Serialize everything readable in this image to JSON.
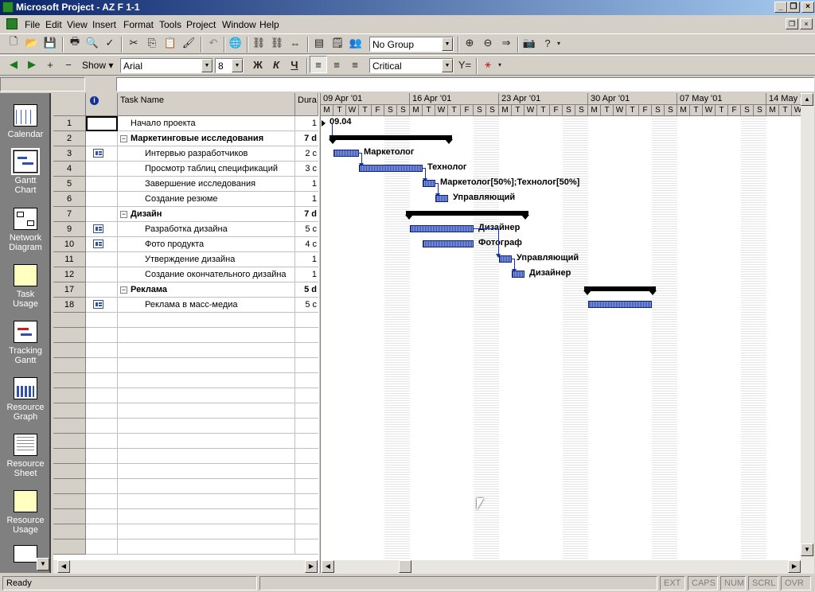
{
  "window": {
    "title": "Microsoft Project - AZ F 1-1"
  },
  "menu": [
    "File",
    "Edit",
    "View",
    "Insert",
    "Format",
    "Tools",
    "Project",
    "Window",
    "Help"
  ],
  "toolbar1": {
    "group_value": "No Group"
  },
  "toolbar2": {
    "show_label": "Show",
    "font_value": "Arial",
    "size_value": "8",
    "bold": "Ж",
    "italic": "К",
    "underline": "Ч",
    "filter_value": "Critical"
  },
  "grid": {
    "columns": {
      "indicators": "i",
      "name": "Task Name",
      "duration": "Dura"
    },
    "rows": [
      {
        "id": "1",
        "name": "Начало проекта",
        "duration": "1",
        "level": 0,
        "summary": false,
        "note": false
      },
      {
        "id": "2",
        "name": "Маркетинговые исследования",
        "duration": "7 d",
        "level": 0,
        "summary": true,
        "note": false
      },
      {
        "id": "3",
        "name": "Интервью разработчиков",
        "duration": "2 c",
        "level": 1,
        "summary": false,
        "note": true
      },
      {
        "id": "4",
        "name": "Просмотр таблиц спецификаций",
        "duration": "3 c",
        "level": 1,
        "summary": false,
        "note": false
      },
      {
        "id": "5",
        "name": "Завершение исследования",
        "duration": "1",
        "level": 1,
        "summary": false,
        "note": false
      },
      {
        "id": "6",
        "name": "Создание резюме",
        "duration": "1",
        "level": 1,
        "summary": false,
        "note": false
      },
      {
        "id": "7",
        "name": "Дизайн",
        "duration": "7 d",
        "level": 0,
        "summary": true,
        "note": false
      },
      {
        "id": "9",
        "name": "Разработка дизайна",
        "duration": "5 c",
        "level": 1,
        "summary": false,
        "note": true
      },
      {
        "id": "10",
        "name": "Фото продукта",
        "duration": "4 c",
        "level": 1,
        "summary": false,
        "note": true
      },
      {
        "id": "11",
        "name": "Утверждение дизайна",
        "duration": "1",
        "level": 1,
        "summary": false,
        "note": false
      },
      {
        "id": "12",
        "name": "Создание окончательного дизайна",
        "duration": "1",
        "level": 1,
        "summary": false,
        "note": false
      },
      {
        "id": "17",
        "name": "Реклама",
        "duration": "5 d",
        "level": 0,
        "summary": true,
        "note": false
      },
      {
        "id": "18",
        "name": "Реклама в масс-медиа",
        "duration": "5 c",
        "level": 1,
        "summary": false,
        "note": true
      }
    ]
  },
  "timescale": {
    "weeks": [
      "09 Apr '01",
      "16 Apr '01",
      "23 Apr '01",
      "30 Apr '01",
      "07 May '01",
      "14 May '"
    ],
    "days": [
      "M",
      "T",
      "W",
      "T",
      "F",
      "S",
      "S"
    ]
  },
  "gantt_labels": {
    "milestone": "09.04",
    "r3": "Маркетолог",
    "r4": "Технолог",
    "r5": "Маркетолог[50%];Технолог[50%]",
    "r6": "Управляющий",
    "r9": "Дизайнер",
    "r10": "Фотограф",
    "r11": "Управляющий",
    "r12": "Дизайнер"
  },
  "viewbar": [
    "Calendar",
    "Gantt Chart",
    "Network Diagram",
    "Task Usage",
    "Tracking Gantt",
    "Resource Graph",
    "Resource Sheet",
    "Resource Usage"
  ],
  "status": {
    "text": "Ready",
    "ext": "EXT",
    "caps": "CAPS",
    "num": "NUM",
    "scrl": "SCRL",
    "ovr": "OVR"
  }
}
